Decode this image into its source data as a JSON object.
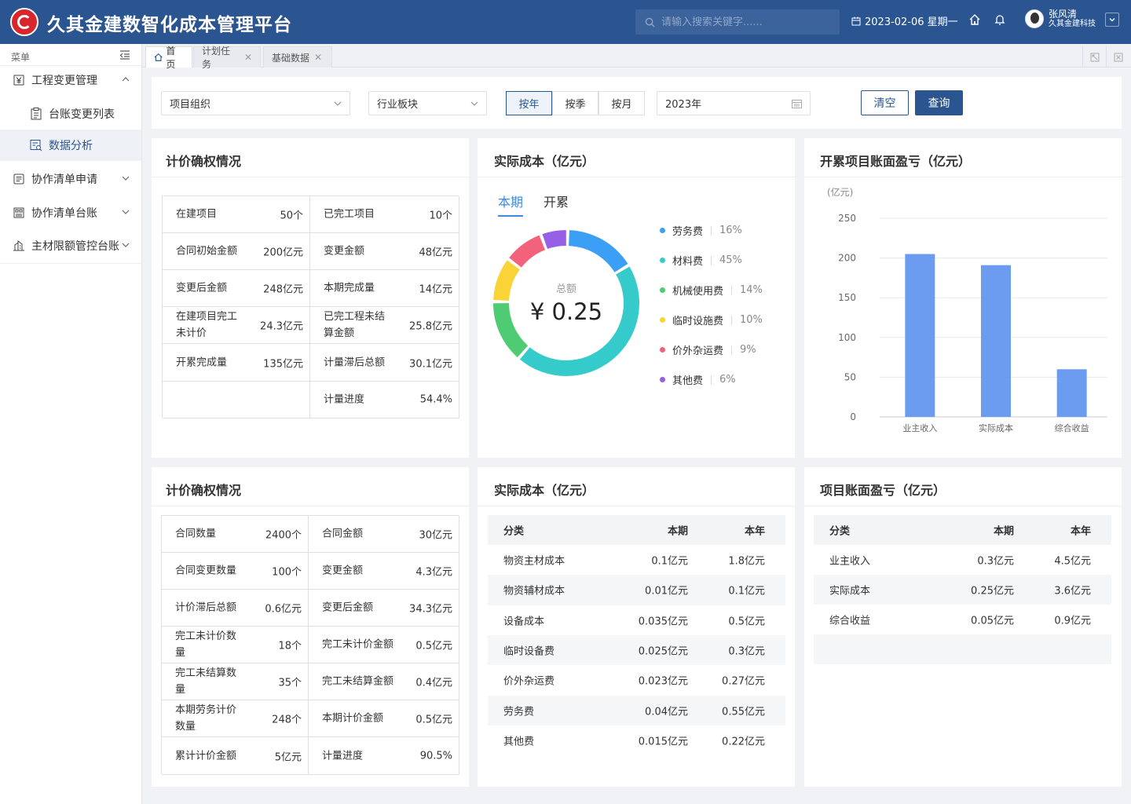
{
  "header": {
    "title": "久其金建数智化成本管理平台",
    "search_placeholder": "请输入搜索关键字......",
    "date": "2023-02-06 星期一",
    "user_name": "张风清",
    "user_org": "久其金建科技"
  },
  "sidebar": {
    "menu_label": "菜单",
    "items": [
      {
        "label": "工程变更管理"
      },
      {
        "label": "台账变更列表"
      },
      {
        "label": "数据分析"
      },
      {
        "label": "协作清单申请"
      },
      {
        "label": "协作清单台账"
      },
      {
        "label": "主材限额管控台账"
      }
    ]
  },
  "tabs": [
    {
      "label": "首页"
    },
    {
      "label": "计划任务"
    },
    {
      "label": "基础数据"
    }
  ],
  "filter": {
    "org_placeholder": "项目组织",
    "sector_placeholder": "行业板块",
    "period_buttons": [
      "按年",
      "按季",
      "按月"
    ],
    "year_value": "2023年",
    "clear_label": "清空",
    "query_label": "查询"
  },
  "card1": {
    "title": "计价确权情况",
    "rows": [
      {
        "l1": "在建项目",
        "v1": "50个",
        "l2": "已完工项目",
        "v2": "10个"
      },
      {
        "l1": "合同初始金额",
        "v1": "200亿元",
        "l2": "变更金额",
        "v2": "48亿元"
      },
      {
        "l1": "变更后金额",
        "v1": "248亿元",
        "l2": "本期完成量",
        "v2": "14亿元"
      },
      {
        "l1": "在建项目完工未计价",
        "v1": "24.3亿元",
        "l2": "已完工程未结算金额",
        "v2": "25.8亿元"
      },
      {
        "l1": "开累完成量",
        "v1": "135亿元",
        "l2": "计量滞后总额",
        "v2": "30.1亿元"
      },
      {
        "l1": "",
        "v1": "",
        "l2": "计量进度",
        "v2": "54.4%"
      }
    ]
  },
  "card2": {
    "title": "实际成本（亿元）",
    "tabs": [
      "本期",
      "开累"
    ],
    "center_label": "总额",
    "center_value": "¥ 0.25",
    "chart_data": {
      "type": "pie",
      "categories": [
        "劳务费",
        "材料费",
        "机械使用费",
        "临时设施费",
        "价外杂运费",
        "其他费"
      ],
      "values": [
        16,
        45,
        14,
        10,
        9,
        6
      ],
      "labels": [
        "16%",
        "45%",
        "14%",
        "10%",
        "9%",
        "6%"
      ],
      "colors": [
        "#3a9ff5",
        "#36cbcb",
        "#4ecb73",
        "#fad337",
        "#f2637b",
        "#975fe5"
      ]
    }
  },
  "card3": {
    "title": "开累项目账面盈亏（亿元）",
    "chart_data": {
      "type": "bar",
      "categories": [
        "业主收入",
        "实际成本",
        "综合收益"
      ],
      "values": [
        205,
        191,
        60
      ],
      "ylabel": "(亿元)",
      "ylim": [
        0,
        250
      ],
      "yticks": [
        "0",
        "50",
        "100",
        "150",
        "200",
        "250"
      ],
      "color": "#6c9cf0"
    }
  },
  "card4": {
    "title": "计价确权情况",
    "rows": [
      {
        "l1": "合同数量",
        "v1": "2400个",
        "l2": "合同金额",
        "v2": "30亿元"
      },
      {
        "l1": "合同变更数量",
        "v1": "100个",
        "l2": "变更金额",
        "v2": "4.3亿元"
      },
      {
        "l1": "计价滞后总额",
        "v1": "0.6亿元",
        "l2": "变更后金额",
        "v2": "34.3亿元"
      },
      {
        "l1": "完工未计价数量",
        "v1": "18个",
        "l2": "完工未计价金额",
        "v2": "0.5亿元"
      },
      {
        "l1": "完工未结算数量",
        "v1": "35个",
        "l2": "完工未结算金额",
        "v2": "0.4亿元"
      },
      {
        "l1": "本期劳务计价数量",
        "v1": "248个",
        "l2": "本期计价金额",
        "v2": "0.5亿元"
      },
      {
        "l1": "累计计价金额",
        "v1": "5亿元",
        "l2": "计量进度",
        "v2": "90.5%"
      }
    ]
  },
  "card5": {
    "title": "实际成本（亿元）",
    "columns": [
      "分类",
      "本期",
      "本年"
    ],
    "rows": [
      [
        "物资主材成本",
        "0.1亿元",
        "1.8亿元"
      ],
      [
        "物资辅材成本",
        "0.01亿元",
        "0.1亿元"
      ],
      [
        "设备成本",
        "0.035亿元",
        "0.5亿元"
      ],
      [
        "临时设备费",
        "0.025亿元",
        "0.3亿元"
      ],
      [
        "价外杂运费",
        "0.023亿元",
        "0.27亿元"
      ],
      [
        "劳务费",
        "0.04亿元",
        "0.55亿元"
      ],
      [
        "其他费",
        "0.015亿元",
        "0.22亿元"
      ]
    ]
  },
  "card6": {
    "title": "项目账面盈亏（亿元）",
    "columns": [
      "分类",
      "本期",
      "本年"
    ],
    "rows": [
      [
        "业主收入",
        "0.3亿元",
        "4.5亿元"
      ],
      [
        "实际成本",
        "0.25亿元",
        "3.6亿元"
      ],
      [
        "综合收益",
        "0.05亿元",
        "0.9亿元"
      ]
    ]
  }
}
